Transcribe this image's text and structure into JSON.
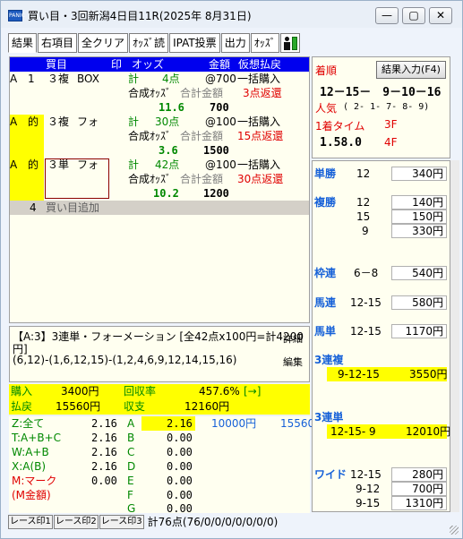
{
  "window": {
    "title": "買い目・3回新潟4日目11R(2025年 8月31日)",
    "app_icon_text": "PANIC",
    "controls": {
      "minimize": "—",
      "maximize": "▢",
      "close": "✕"
    }
  },
  "toolbar": {
    "tabs": [
      "結果",
      "右項目",
      "全クリア",
      "ｵｯｽﾞ読",
      "IPAT投票",
      "出力",
      "ｵｯｽﾞ"
    ]
  },
  "bets": {
    "headers": {
      "buy": "買目",
      "mark": "印",
      "odds": "オッズ",
      "amount": "金額",
      "forecast": "仮想払戻"
    },
    "rows": [
      {
        "tag": "A",
        "num": "1",
        "type": "３複",
        "method": "BOX",
        "count_label": "計",
        "count": "4点",
        "unit": "@700",
        "purchase": "一括購入",
        "synth_label": "合成ｵｯｽﾞ",
        "total_label": "合計金額",
        "refund": "3点返還",
        "synth": "11.6",
        "total": "700"
      },
      {
        "tag": "A",
        "num": "的",
        "type": "３複",
        "method": "フォ",
        "count_label": "計",
        "count": "30点",
        "unit": "@100",
        "purchase": "一括購入",
        "synth_label": "合成ｵｯｽﾞ",
        "total_label": "合計金額",
        "refund": "15点返還",
        "synth": "3.6",
        "total": "1500"
      },
      {
        "tag": "A",
        "num": "的",
        "type": "３単",
        "method": "フォ",
        "count_label": "計",
        "count": "42点",
        "unit": "@100",
        "purchase": "一括購入",
        "synth_label": "合成ｵｯｽﾞ",
        "total_label": "合計金額",
        "refund": "30点返還",
        "synth": "10.2",
        "total": "1200"
      }
    ],
    "add_row": {
      "num": "4",
      "label": "買い目追加"
    }
  },
  "detail": {
    "line1": "【A:3】3連単・フォーメーション [全42点x100円=計4200",
    "line2": "円]",
    "line3": "(6,12)-(1,6,12,15)-(1,2,4,6,9,12,14,15,16)",
    "detail_button": "詳細",
    "edit_button": "編集"
  },
  "summary": {
    "purchase_label": "購入",
    "purchase": "3400円",
    "payout_label": "払戻",
    "payout": "15560円",
    "rate_label": "回収率",
    "rate": "457.6%",
    "rate_arrow": "[→]",
    "balance_label": "収支",
    "balance": "12160円"
  },
  "simulation": {
    "left": [
      {
        "label": "Z:全て",
        "value": "2.16"
      },
      {
        "label": "T:A+B+C",
        "value": "2.16"
      },
      {
        "label": "W:A+B",
        "value": "2.16"
      },
      {
        "label": "X:A(B)",
        "value": "2.16"
      },
      {
        "label": "M:マーク",
        "value": "0.00"
      },
      {
        "label": "(M金額)",
        "value": ""
      }
    ],
    "right": [
      {
        "label": "A",
        "value": "2.16",
        "amount": "10000円",
        "payout": "15560"
      },
      {
        "label": "B",
        "value": "0.00"
      },
      {
        "label": "C",
        "value": "0.00"
      },
      {
        "label": "D",
        "value": "0.00"
      },
      {
        "label": "E",
        "value": "0.00"
      },
      {
        "label": "F",
        "value": "0.00"
      },
      {
        "label": "G",
        "value": "0.00"
      }
    ]
  },
  "result": {
    "order_label": "着順",
    "input_button": "結果入力(F4)",
    "order": "12－15－　9－10－16",
    "popularity_label": "人気",
    "popularity": "( 2- 1- 7- 8- 9)",
    "first_time_label": "1着タイム",
    "first_time": "1.58.0",
    "f3": "3F",
    "f4": "4F"
  },
  "payouts": {
    "win": {
      "label": "単勝",
      "rows": [
        {
          "combo": "12",
          "amount": "340円"
        }
      ]
    },
    "place": {
      "label": "複勝",
      "rows": [
        {
          "combo": "12",
          "amount": "140円"
        },
        {
          "combo": "15",
          "amount": "150円"
        },
        {
          "combo": "9",
          "amount": "330円"
        }
      ]
    },
    "bracket": {
      "label": "枠連",
      "rows": [
        {
          "combo": "6－8",
          "amount": "540円"
        }
      ]
    },
    "quinella": {
      "label": "馬連",
      "rows": [
        {
          "combo": "12-15",
          "amount": "580円"
        }
      ]
    },
    "exacta": {
      "label": "馬単",
      "rows": [
        {
          "combo": "12-15",
          "amount": "1170円"
        }
      ]
    },
    "trio": {
      "label": "3連複",
      "rows": [
        {
          "combo": "9-12-15",
          "amount": "3550円"
        }
      ]
    },
    "trifecta": {
      "label": "3連単",
      "rows": [
        {
          "combo": "12-15- 9",
          "amount": "12010円"
        }
      ]
    },
    "wide": {
      "label": "ワイド",
      "rows": [
        {
          "combo": "12-15",
          "amount": "280円"
        },
        {
          "combo": "9-12",
          "amount": "700円"
        },
        {
          "combo": "9-15",
          "amount": "1310円"
        }
      ]
    }
  },
  "status": {
    "buttons": [
      "レース印1",
      "レース印2",
      "レース印3"
    ],
    "text": "計76点(76/0/0/0/0/0/0/0)"
  },
  "colors": {
    "header_blue": "#0000ee",
    "highlight_yellow": "#ffff00",
    "odds_green": "#008800",
    "alert_red": "#e00000",
    "payout_blue": "#1560d8"
  }
}
